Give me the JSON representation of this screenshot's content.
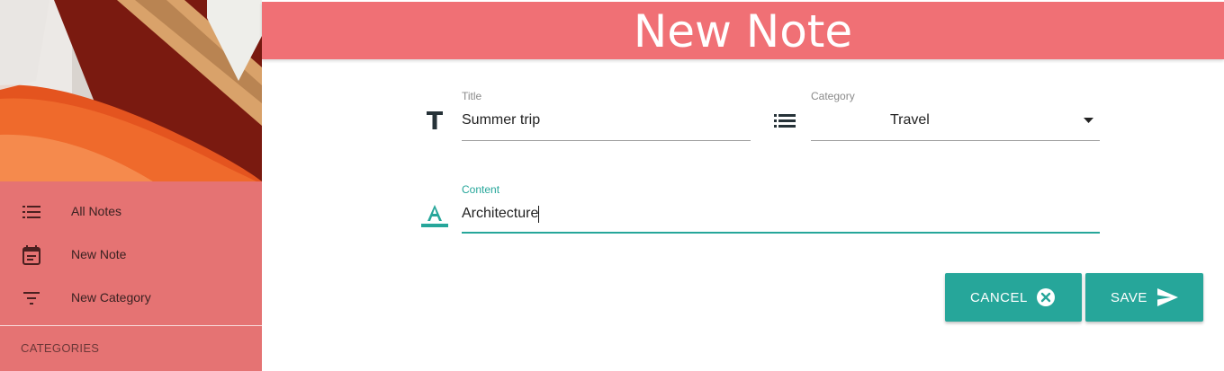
{
  "header": {
    "title": "New Note"
  },
  "sidebar": {
    "nav": [
      {
        "label": "All Notes",
        "icon": "list-icon"
      },
      {
        "label": "New Note",
        "icon": "calendar-note-icon"
      },
      {
        "label": "New Category",
        "icon": "filter-icon"
      }
    ],
    "categories_header": "CATEGORIES"
  },
  "form": {
    "title": {
      "label": "Title",
      "value": "Summer trip",
      "icon": "title-icon"
    },
    "category": {
      "label": "Category",
      "value": "Travel",
      "icon": "list-icon"
    },
    "content": {
      "label": "Content",
      "value": "Architecture",
      "icon": "text-format-icon"
    }
  },
  "buttons": {
    "cancel": {
      "label": "CANCEL",
      "icon": "cancel-circle-icon"
    },
    "save": {
      "label": "SAVE",
      "icon": "send-icon"
    }
  },
  "colors": {
    "header": "#f07075",
    "sidebar": "#e57373",
    "accent": "#26a69a"
  }
}
